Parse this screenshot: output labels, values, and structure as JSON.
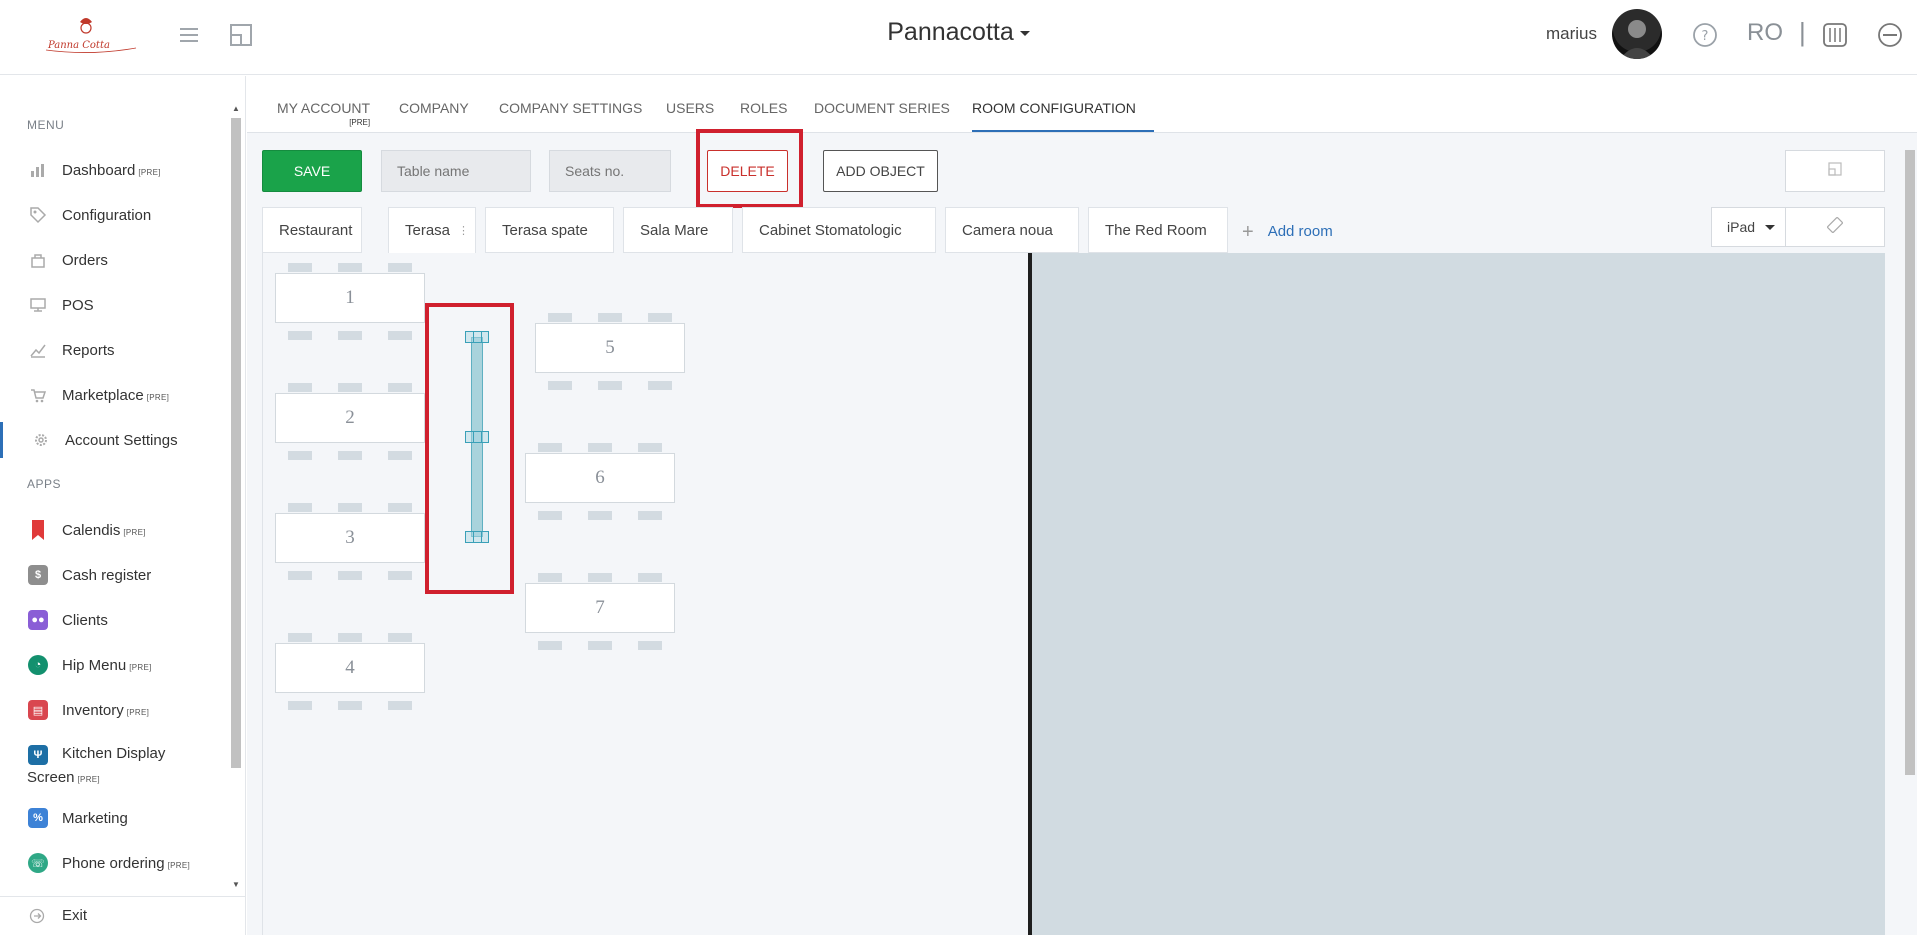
{
  "header": {
    "company": "Pannacotta",
    "username": "marius",
    "language": "RO",
    "separator": "|",
    "logo_text": "Panna Cotta"
  },
  "sidebar": {
    "menu_heading": "MENU",
    "apps_heading": "APPS",
    "menu_items": [
      {
        "label": "Dashboard",
        "pre": "[PRE]",
        "icon": "chart-icon"
      },
      {
        "label": "Configuration",
        "pre": "",
        "icon": "tag-icon"
      },
      {
        "label": "Orders",
        "pre": "",
        "icon": "bag-icon"
      },
      {
        "label": "POS",
        "pre": "",
        "icon": "monitor-icon"
      },
      {
        "label": "Reports",
        "pre": "",
        "icon": "line-chart-icon"
      },
      {
        "label": "Marketplace",
        "pre": "[PRE]",
        "icon": "cart-icon"
      },
      {
        "label": "Account Settings",
        "pre": "",
        "icon": "gear-icon"
      }
    ],
    "app_items": [
      {
        "label": "Calendis",
        "pre": "[PRE]",
        "color": "#e03a3a"
      },
      {
        "label": "Cash register",
        "pre": "",
        "color": "#8e8e8e"
      },
      {
        "label": "Clients",
        "pre": "",
        "color": "#8a5ed6"
      },
      {
        "label": "Hip Menu",
        "pre": "[PRE]",
        "color": "#13906e"
      },
      {
        "label": "Inventory",
        "pre": "[PRE]",
        "color": "#d9464f"
      },
      {
        "label": "Kitchen Display",
        "label2": "Screen",
        "pre": "[PRE]",
        "color": "#1d6fa5"
      },
      {
        "label": "Marketing",
        "pre": "",
        "color": "#3d82d6"
      },
      {
        "label": "Phone ordering",
        "pre": "[PRE]",
        "color": "#2fa886"
      }
    ],
    "exit_label": "Exit"
  },
  "tabs": [
    {
      "label": "MY ACCOUNT",
      "sup": "[PRE]"
    },
    {
      "label": "COMPANY"
    },
    {
      "label": "COMPANY SETTINGS"
    },
    {
      "label": "USERS"
    },
    {
      "label": "ROLES"
    },
    {
      "label": "DOCUMENT SERIES"
    },
    {
      "label": "ROOM CONFIGURATION",
      "active": true
    }
  ],
  "toolbar": {
    "save_label": "SAVE",
    "table_name_placeholder": "Table name",
    "seats_placeholder": "Seats no.",
    "delete_label": "DELETE",
    "add_object_label": "ADD OBJECT"
  },
  "rooms": [
    "Restaurant",
    "Terasa",
    "Terasa spate",
    "Sala Mare",
    "Cabinet Stomatologic",
    "Camera noua",
    "The Red Room"
  ],
  "active_room": "Terasa",
  "add_room_label": "Add room",
  "device": "iPad",
  "tables": [
    "1",
    "2",
    "3",
    "4",
    "5",
    "6",
    "7"
  ],
  "colors": {
    "accent": "#2d6fb7",
    "save": "#1aa34a",
    "delete": "#c9302c",
    "highlight": "#d0202e"
  }
}
